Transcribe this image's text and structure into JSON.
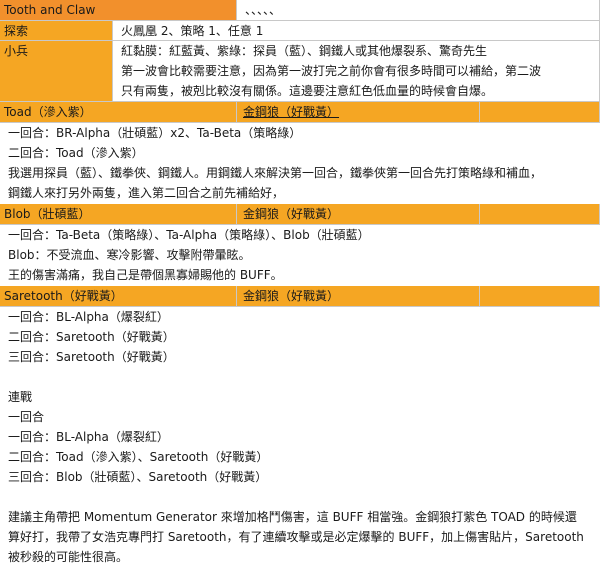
{
  "title_row": {
    "title": "Tooth and Claw",
    "dots": "、、、、、"
  },
  "scout": {
    "label": "探索",
    "value": "火鳳凰 2、策略 1、任意 1"
  },
  "minion": {
    "label": "小兵",
    "lines": [
      "紅黏膜：紅藍黃、紫綠：探員（藍）、鋼鐵人或其他爆裂系、驚奇先生",
      "第一波會比較需要注意，因為第一波打完之前你會有很多時間可以補給，第二波",
      "只有兩隻，被剋比較沒有關係。這邊要注意紅色低血量的時候會自爆。"
    ]
  },
  "toad": {
    "header": "Toad（滲入紫）",
    "rival": "金鋼狼（好戰黃）",
    "lines": [
      "一回合：BR-Alpha（壯碩藍）x2、Ta-Beta（策略綠）",
      "二回合：Toad（滲入紫）",
      "我選用探員（藍）、鐵拳俠、鋼鐵人。用鋼鐵人來解決第一回合，鐵拳俠第一回合先打策略綠和補血，",
      "鋼鐵人來打另外兩隻，進入第二回合之前先補給好，"
    ]
  },
  "blob": {
    "header": "Blob（壯碩藍）",
    "rival": "金鋼狼（好戰黃）",
    "lines": [
      "一回合：Ta-Beta（策略綠）、Ta-Alpha（策略綠）、Blob（壯碩藍）",
      "Blob：不受流血、寒冷影響、攻擊附帶暈眩。",
      "王的傷害滿痛，我自己是帶個黑寡婦賜他的 BUFF。"
    ]
  },
  "saretooth": {
    "header": "Saretooth（好戰黃）",
    "rival": "金鋼狼（好戰黃）",
    "lines": [
      "一回合：BL-Alpha（爆裂紅）",
      "二回合：Saretooth（好戰黃）",
      "三回合：Saretooth（好戰黃）"
    ]
  },
  "streak": {
    "title": "連戰",
    "lines": [
      "一回合",
      "一回合：BL-Alpha（爆裂紅）",
      "二回合：Toad（滲入紫）、Saretooth（好戰黃）",
      "三回合：Blob（壯碩藍）、Saretooth（好戰黃）"
    ]
  },
  "note": {
    "lines": [
      "建議主角帶把 Momentum Generator 來增加格鬥傷害，這 BUFF 相當強。金鋼狼打紫色 TOAD 的時候還",
      "算好打，我帶了女浩克專門打 Saretooth，有了連續攻擊或是必定爆擊的 BUFF，加上傷害貼片，Saretooth",
      "被秒殺的可能性很高。"
    ]
  }
}
